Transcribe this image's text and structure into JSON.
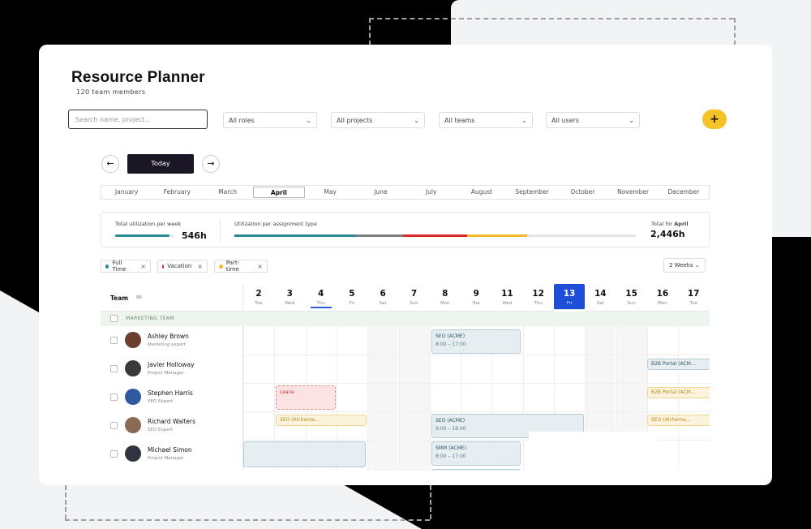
{
  "header": {
    "title": "Resource Planner",
    "subtitle": "120 team members"
  },
  "filters": {
    "search_placeholder": "Search name, project...",
    "roles": "All roles",
    "projects": "All projects",
    "teams": "All teams",
    "users": "All users",
    "add_label": "+"
  },
  "navigation": {
    "prev": "←",
    "next": "→",
    "today": "Today",
    "months": [
      "January",
      "February",
      "March",
      "April",
      "May",
      "June",
      "July",
      "August",
      "September",
      "October",
      "November",
      "December"
    ],
    "active_month": "April"
  },
  "utilization": {
    "per_week_label": "Total utilization per week",
    "per_week_value": "546h",
    "per_week_fraction": 0.55,
    "per_type_label": "Utilization per assignment type",
    "total_label_prefix": "Total for",
    "total_label_month": "April",
    "total_value": "2,446h",
    "segments": [
      {
        "color": "#2a8a9a",
        "fraction": 0.3
      },
      {
        "color": "#7a7f85",
        "fraction": 0.12
      },
      {
        "color": "#d92b2b",
        "fraction": 0.16
      },
      {
        "color": "#f5b82e",
        "fraction": 0.15
      }
    ]
  },
  "legend_chips": [
    {
      "label": "Full Time",
      "color": "#2a8a9a"
    },
    {
      "label": "Vacation",
      "color": "#d92b2b"
    },
    {
      "label": "Part-time",
      "color": "#f5b82e"
    }
  ],
  "range_select": "2 Weeks",
  "team_header": {
    "label": "Team",
    "count": "86"
  },
  "days": [
    {
      "num": "2",
      "wd": "Tue"
    },
    {
      "num": "3",
      "wd": "Wed"
    },
    {
      "num": "4",
      "wd": "Thu"
    },
    {
      "num": "5",
      "wd": "Fri"
    },
    {
      "num": "6",
      "wd": "Sat"
    },
    {
      "num": "7",
      "wd": "Sun"
    },
    {
      "num": "8",
      "wd": "Mon"
    },
    {
      "num": "9",
      "wd": "Tue"
    },
    {
      "num": "11",
      "wd": "Wed"
    },
    {
      "num": "12",
      "wd": "Thu"
    },
    {
      "num": "13",
      "wd": "Fri"
    },
    {
      "num": "14",
      "wd": "Sat"
    },
    {
      "num": "15",
      "wd": "Sun"
    },
    {
      "num": "16",
      "wd": "Mon"
    },
    {
      "num": "17",
      "wd": "Tue"
    }
  ],
  "group_name": "MARKETING TEAM",
  "members": [
    {
      "name": "Ashley Brown",
      "role": "Marketing expert",
      "avatar_color": "#6b3e2e"
    },
    {
      "name": "Javier Holloway",
      "role": "Project Manager",
      "avatar_color": "#3a3a3a"
    },
    {
      "name": "Stephen Harris",
      "role": "SEO Expert",
      "avatar_color": "#2d5aa0"
    },
    {
      "name": "Richard Walters",
      "role": "SEO Expert",
      "avatar_color": "#8a6a55"
    },
    {
      "name": "Michael Simon",
      "role": "Project Manager",
      "avatar_color": "#2f3440"
    }
  ],
  "events": {
    "seo_acme": "SEO (ACME)",
    "time_8_17": "8:00 – 17:00",
    "b2b_portal": "B2B Portal (ACM...",
    "leave": "Leave",
    "seo_alchema_1": "SEO (Alchema...",
    "seo_acme_2": "SEO (ACME)",
    "time_9_18": "9:00 – 18:00",
    "seo_alchema_2": "SEO (Alchema...",
    "smm_acme": "SMM (ACME)",
    "time_8_17_b": "8:00 – 17:00"
  }
}
